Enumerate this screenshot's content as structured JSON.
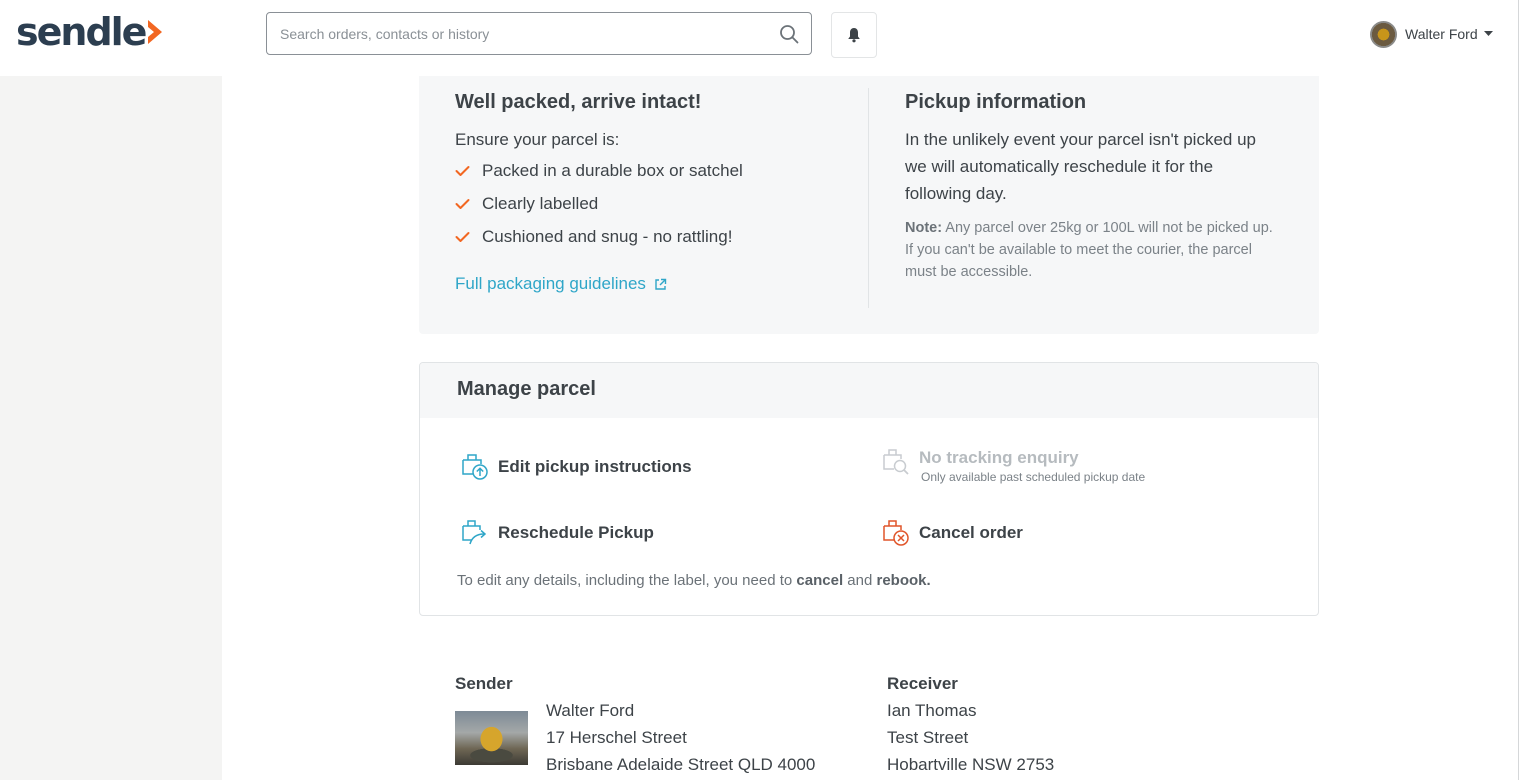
{
  "header": {
    "logo_text": "sendle",
    "search": {
      "placeholder": "Search orders, contacts or history",
      "value": ""
    },
    "user": {
      "name": "Walter Ford"
    }
  },
  "colors": {
    "brand_dark": "#2c3e50",
    "brand_orange": "#f26722",
    "link": "#2fa6c8",
    "panel_bg": "#f6f7f8",
    "sidebar_bg": "#f4f4f3"
  },
  "packing": {
    "title": "Well packed, arrive intact!",
    "intro": "Ensure your parcel is:",
    "checklist": [
      "Packed in a durable box or satchel",
      "Clearly labelled",
      "Cushioned and snug - no rattling!"
    ],
    "guidelines_link": "Full packaging guidelines"
  },
  "pickup_info": {
    "title": "Pickup information",
    "body_lines": [
      "In the unlikely event your parcel isn't picked up",
      "we will automatically reschedule it for the",
      "following day."
    ],
    "note_label": "Note:",
    "note_text": " Any parcel over 25kg or 100L will not be picked up. If you can't be available to meet the courier, the parcel must be accessible."
  },
  "manage": {
    "title": "Manage parcel",
    "actions": {
      "edit_pickup": "Edit pickup instructions",
      "tracking": "No tracking enquiry",
      "tracking_sub": "Only available past scheduled pickup date",
      "reschedule": "Reschedule Pickup",
      "cancel": "Cancel order"
    },
    "footer_prefix": "To edit any details, including the label, you need to ",
    "footer_cancel": "cancel",
    "footer_and": " and ",
    "footer_rebook": "rebook."
  },
  "sender": {
    "title": "Sender",
    "name": "Walter Ford",
    "street": "17 Herschel Street",
    "city": "Brisbane Adelaide Street QLD 4000"
  },
  "receiver": {
    "title": "Receiver",
    "name": "Ian Thomas",
    "street": "Test Street",
    "city": "Hobartville NSW 2753"
  }
}
